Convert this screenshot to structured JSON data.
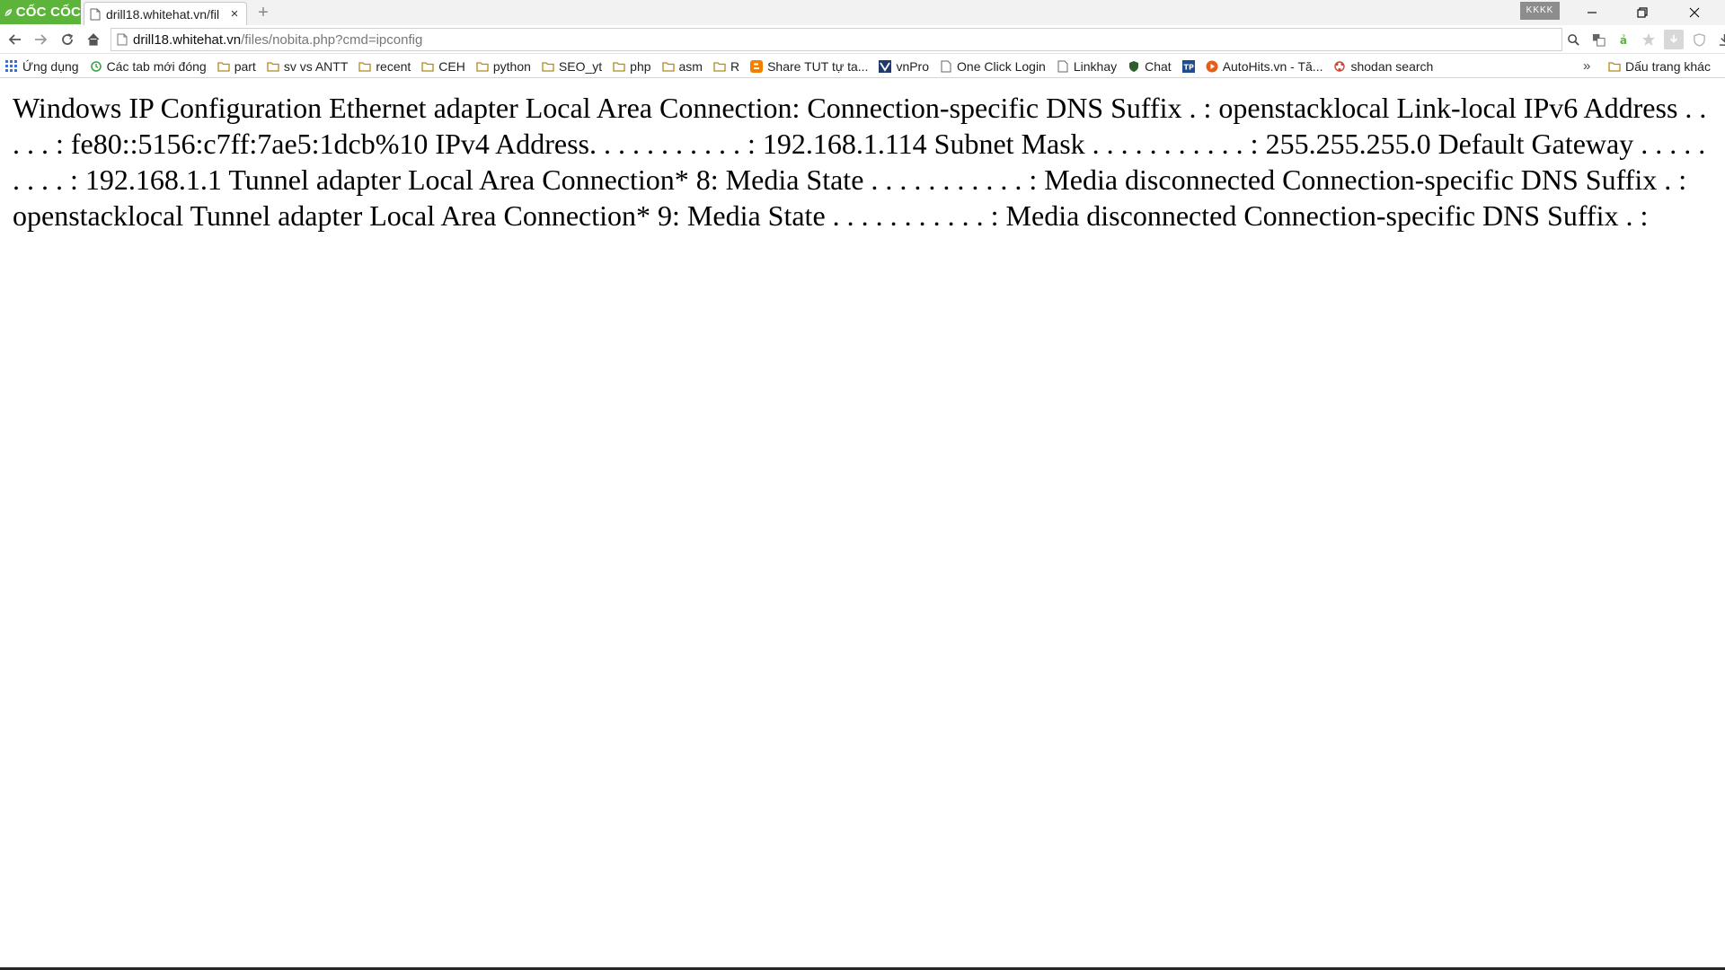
{
  "browser": {
    "logo_text": "CỐC CỐC",
    "tab_title": "drill18.whitehat.vn/fil",
    "tab_close": "×",
    "new_tab": "+",
    "profile_badge": "KKKK",
    "url_host": "drill18.whitehat.vn",
    "url_path": "/files/nobita.php?cmd=ipconfig"
  },
  "bookmarks": {
    "items": [
      {
        "label": "Ứng dụng",
        "icon": "apps-grid-icon"
      },
      {
        "label": "Các tab mới đóng",
        "icon": "history-icon"
      },
      {
        "label": "part",
        "icon": "folder-icon"
      },
      {
        "label": "sv vs ANTT",
        "icon": "folder-icon"
      },
      {
        "label": "recent",
        "icon": "folder-icon"
      },
      {
        "label": "CEH",
        "icon": "folder-icon"
      },
      {
        "label": "python",
        "icon": "folder-icon"
      },
      {
        "label": "SEO_yt",
        "icon": "folder-icon"
      },
      {
        "label": "php",
        "icon": "folder-icon"
      },
      {
        "label": "asm",
        "icon": "folder-icon"
      },
      {
        "label": "R",
        "icon": "folder-icon"
      },
      {
        "label": "Share TUT tự ta...",
        "icon": "blogger-icon"
      },
      {
        "label": "vnPro",
        "icon": "vnpro-icon"
      },
      {
        "label": "One Click Login",
        "icon": "page-icon"
      },
      {
        "label": "Linkhay",
        "icon": "page-icon"
      },
      {
        "label": "Chat",
        "icon": "shield-icon"
      },
      {
        "label": "",
        "icon": "tp-icon"
      },
      {
        "label": "AutoHits.vn - Tă...",
        "icon": "play-icon"
      },
      {
        "label": "shodan search",
        "icon": "shodan-icon"
      }
    ],
    "more": "»",
    "other_label": "Dấu trang khác"
  },
  "page": {
    "text": "Windows IP Configuration Ethernet adapter Local Area Connection: Connection-specific DNS Suffix . : openstacklocal Link-local IPv6 Address . . . . . : fe80::5156:c7ff:7ae5:1dcb%10 IPv4 Address. . . . . . . . . . . : 192.168.1.114 Subnet Mask . . . . . . . . . . . : 255.255.255.0 Default Gateway . . . . . . . . . : 192.168.1.1 Tunnel adapter Local Area Connection* 8: Media State . . . . . . . . . . . : Media disconnected Connection-specific DNS Suffix . : openstacklocal Tunnel adapter Local Area Connection* 9: Media State . . . . . . . . . . . : Media disconnected Connection-specific DNS Suffix . :"
  },
  "colors": {
    "brand_green": "#5cb53a",
    "folder": "#c9a227"
  }
}
